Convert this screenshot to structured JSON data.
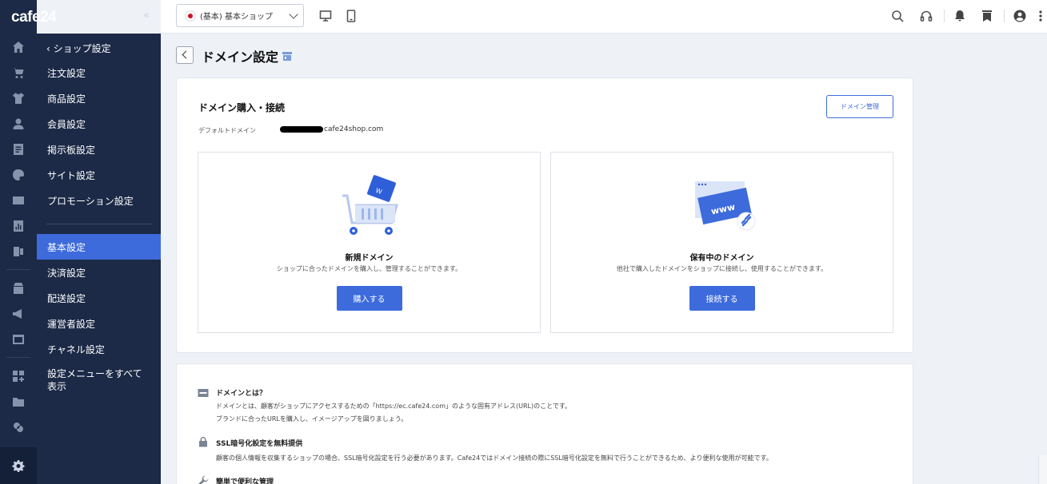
{
  "brand": {
    "logo": "cafe24",
    "collapse_glyph": "«"
  },
  "submenu": {
    "back_label": "‹  ショップ設定",
    "items": [
      "注文設定",
      "商品設定",
      "会員設定",
      "掲示板設定",
      "サイト設定",
      "プロモーション設定"
    ],
    "items2": [
      "基本設定",
      "決済設定",
      "配送設定",
      "運営者設定",
      "チャネル設定"
    ],
    "active": "基本設定",
    "all_settings": "設定メニューをすべて表示"
  },
  "topbar": {
    "shop_selector": "(基本) 基本ショップ"
  },
  "page": {
    "title": "ドメイン設定"
  },
  "domain_card": {
    "title": "ドメイン購入・接続",
    "manage_button": "ドメイン管理",
    "default_domain_label": "デフォルトドメイン",
    "default_domain_suffix": "cafe24shop.com",
    "new_domain": {
      "title": "新規ドメイン",
      "description": "ショップに合ったドメインを購入し、管理することができます。",
      "button": "購入する"
    },
    "owned_domain": {
      "title": "保有中のドメイン",
      "description": "他社で購入したドメインをショップに接続し、使用することができます。",
      "button": "接続する",
      "illustration_text": "www"
    }
  },
  "info_card": {
    "sections": [
      {
        "title": "ドメインとは？",
        "lines": [
          "ドメインとは、顧客がショップにアクセスするための「https://ec.cafe24.com」のような固有アドレス(URL)のことです。",
          "ブランドに合ったURLを購入し、イメージアップを図りましょう。"
        ]
      },
      {
        "title": "SSL暗号化設定を無料提供",
        "lines": [
          "顧客の個人情報を収集するショップの場合、SSL暗号化設定を行う必要があります。Cafe24ではドメイン接続の際にSSL暗号化設定を無料で行うことができるため、より便利な使用が可能です。"
        ]
      },
      {
        "title": "簡単で便利な管理",
        "lines": []
      }
    ]
  },
  "colors": {
    "primary": "#3d6bdc",
    "sidebar": "#1c2a47"
  }
}
